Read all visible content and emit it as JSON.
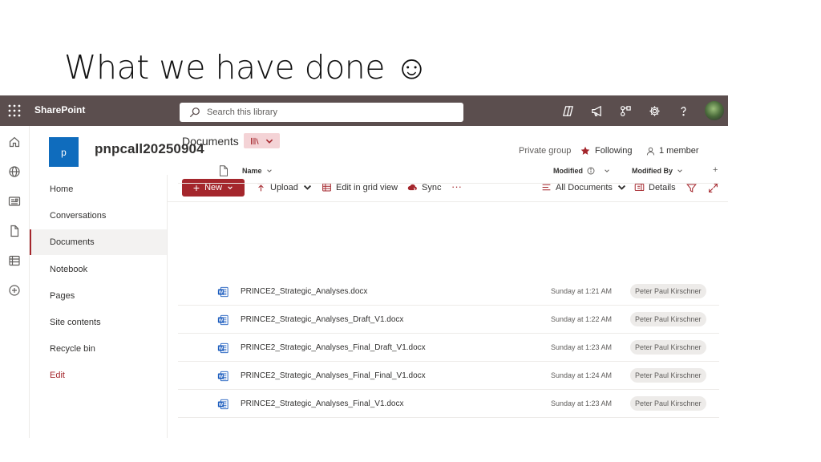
{
  "slide": {
    "title": "What we have done ☺"
  },
  "suitebar": {
    "app_name": "SharePoint",
    "search_placeholder": "Search this library",
    "icons": [
      "copilot-icon",
      "megaphone-icon",
      "network-icon",
      "gear-icon",
      "help-icon",
      "avatar"
    ]
  },
  "rail": {
    "icons": [
      "home-icon",
      "globe-icon",
      "news-icon",
      "file-icon",
      "lists-icon",
      "add-icon"
    ]
  },
  "site": {
    "logo_letter": "p",
    "name": "pnpcall20250904",
    "privacy": "Private group",
    "following": "Following",
    "members": "1 member"
  },
  "nav": {
    "items": [
      {
        "label": "Home"
      },
      {
        "label": "Conversations"
      },
      {
        "label": "Documents",
        "active": true
      },
      {
        "label": "Notebook"
      },
      {
        "label": "Pages"
      },
      {
        "label": "Site contents"
      },
      {
        "label": "Recycle bin"
      },
      {
        "label": "Edit"
      }
    ]
  },
  "commands": {
    "new": "New",
    "upload": "Upload",
    "grid": "Edit in grid view",
    "sync": "Sync",
    "more": "···",
    "view": "All Documents",
    "details": "Details"
  },
  "library": {
    "heading": "Documents",
    "columns": {
      "name": "Name",
      "modified": "Modified",
      "modified_by": "Modified By",
      "add": "+"
    },
    "files": [
      {
        "name": "PRINCE2_Strategic_Analyses.docx",
        "modified": "Sunday at 1:21 AM",
        "modified_by": "Peter Paul Kirschner"
      },
      {
        "name": "PRINCE2_Strategic_Analyses_Draft_V1.docx",
        "modified": "Sunday at 1:22 AM",
        "modified_by": "Peter Paul Kirschner"
      },
      {
        "name": "PRINCE2_Strategic_Analyses_Final_Draft_V1.docx",
        "modified": "Sunday at 1:23 AM",
        "modified_by": "Peter Paul Kirschner"
      },
      {
        "name": "PRINCE2_Strategic_Analyses_Final_Final_V1.docx",
        "modified": "Sunday at 1:24 AM",
        "modified_by": "Peter Paul Kirschner"
      },
      {
        "name": "PRINCE2_Strategic_Analyses_Final_V1.docx",
        "modified": "Sunday at 1:23 AM",
        "modified_by": "Peter Paul Kirschner"
      }
    ]
  },
  "colors": {
    "suitebar": "#5b4e4e",
    "accent": "#a4262c",
    "site_logo": "#0f6cbd",
    "word": "#185abd"
  }
}
